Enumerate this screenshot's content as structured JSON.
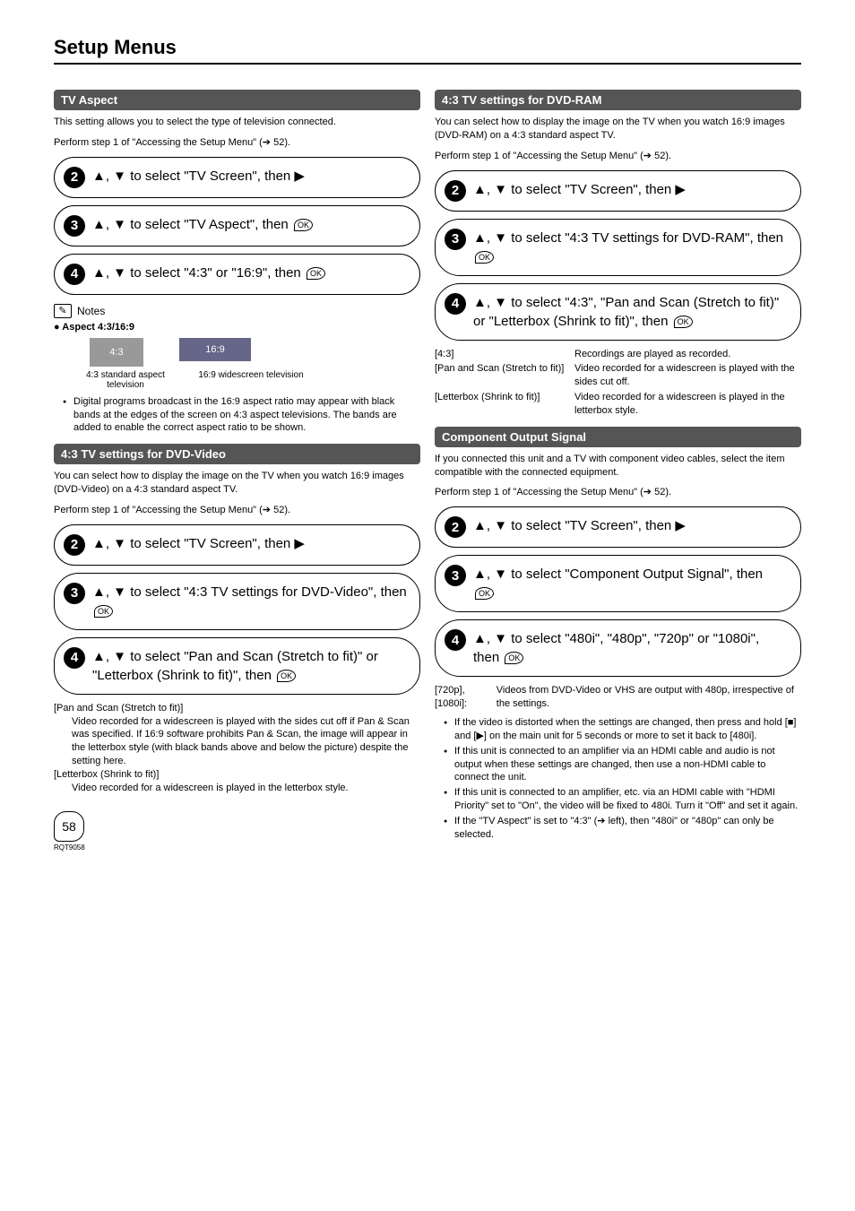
{
  "page": {
    "title": "Setup Menus",
    "number": "58",
    "code": "RQT9058"
  },
  "left": {
    "tvaspect": {
      "heading": "TV Aspect",
      "intro1": "This setting allows you to select the type of television connected.",
      "intro2": "Perform step 1 of \"Accessing the Setup Menu\" (➔ 52).",
      "step2": "▲, ▼ to select \"TV Screen\", then ▶",
      "step3": "▲, ▼ to select \"TV Aspect\", then ",
      "step4": "▲, ▼ to select \"4:3\" or \"16:9\", then ",
      "notesLabel": "Notes",
      "aspectTitle": "● Aspect 4:3/16:9",
      "box43": "4:3",
      "box169": "16:9",
      "cap43": "4:3 standard aspect television",
      "cap169": "16:9 widescreen television",
      "notesBullet": "Digital programs broadcast in the 16:9 aspect ratio may appear with black bands at the edges of the screen on 4:3 aspect televisions. The bands are added to enable the correct aspect ratio to be shown."
    },
    "dvdvideo": {
      "heading": "4:3 TV settings for DVD-Video",
      "intro1": "You can select how to display the image on the TV when you watch 16:9 images (DVD-Video) on a 4:3 standard aspect TV.",
      "intro2": "Perform step 1 of \"Accessing the Setup Menu\" (➔ 52).",
      "step2": "▲, ▼ to select \"TV Screen\", then ▶",
      "step3": "▲, ▼ to select \"4:3 TV settings for DVD-Video\", then ",
      "step4": "▲, ▼ to select \"Pan and Scan (Stretch to fit)\" or \"Letterbox (Shrink to fit)\", then ",
      "def1key": "[Pan and Scan (Stretch to fit)]",
      "def1val": "Video recorded for a widescreen is played with the sides cut off if Pan & Scan was specified. If 16:9 software prohibits Pan & Scan, the image will appear in the letterbox style (with black bands above and below the picture) despite the setting here.",
      "def2key": "[Letterbox (Shrink to fit)]",
      "def2val": "Video recorded for a widescreen is played in the letterbox style."
    }
  },
  "right": {
    "dvdram": {
      "heading": "4:3 TV settings for DVD-RAM",
      "intro1": "You can select how to display the image on the TV when you watch 16:9 images (DVD-RAM) on a 4:3 standard aspect TV.",
      "intro2": "Perform step 1 of \"Accessing the Setup Menu\" (➔ 52).",
      "step2": "▲, ▼ to select \"TV Screen\", then ▶",
      "step3": "▲, ▼ to select \"4:3 TV settings for DVD-RAM\", then ",
      "step4": "▲, ▼ to select \"4:3\", \"Pan and Scan (Stretch to fit)\" or \"Letterbox (Shrink to fit)\", then ",
      "row1k": "[4:3]",
      "row1v": "Recordings are played as recorded.",
      "row2k": "[Pan and Scan (Stretch to fit)]",
      "row2v": "Video recorded for a widescreen is played with the sides cut off.",
      "row3k": "[Letterbox (Shrink to fit)]",
      "row3v": "Video recorded for a widescreen is played in the letterbox style."
    },
    "component": {
      "heading": "Component Output Signal",
      "intro1": "If you connected this unit and a TV with component video cables, select the item compatible with the connected equipment.",
      "intro2": "Perform step 1 of \"Accessing the Setup Menu\" (➔ 52).",
      "step2": "▲, ▼ to select \"TV Screen\", then ▶",
      "step3": "▲, ▼ to select \"Component Output Signal\", then ",
      "step4": "▲, ▼ to select \"480i\", \"480p\", \"720p\" or \"1080i\", then ",
      "noteTopK": "[720p], [1080i]:",
      "noteTopV": "Videos from DVD-Video or VHS are output with 480p, irrespective of the settings.",
      "b1": "If the video is distorted when the settings are changed, then press and hold [■] and [▶] on the main unit for 5 seconds or more to set it back to [480i].",
      "b2": "If this unit is connected to an amplifier via an HDMI cable and audio is not output when these settings are changed, then use a non-HDMI cable to connect the unit.",
      "b3": "If this unit is connected to an amplifier, etc. via an HDMI cable with \"HDMI Priority\" set to \"On\", the video will be fixed to 480i. Turn it \"Off\" and set it again.",
      "b4": "If the \"TV Aspect\" is set to \"4:3\" (➔ left), then \"480i\" or \"480p\" can only be selected."
    }
  }
}
